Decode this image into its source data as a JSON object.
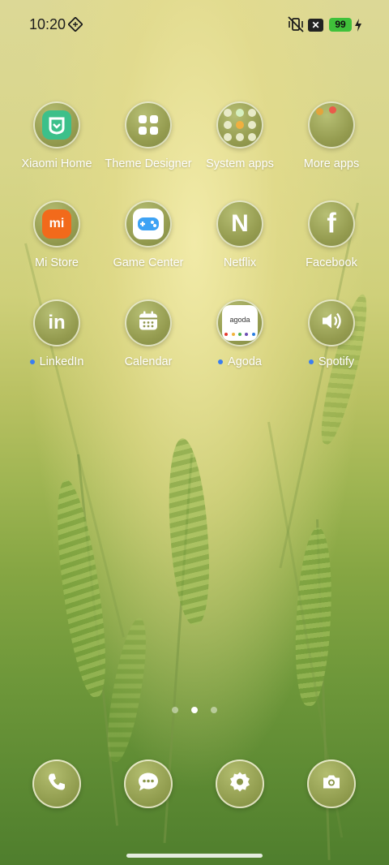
{
  "status_bar": {
    "time": "10:20",
    "battery_level": "99",
    "icons": [
      "nfc-icon",
      "mute-vibrate-icon",
      "xbox-badge-icon",
      "battery-icon",
      "charging-icon"
    ]
  },
  "apps": [
    {
      "label": "Xiaomi Home",
      "icon": "xiaomi-home-icon",
      "notification": false
    },
    {
      "label": "Theme Designer",
      "icon": "theme-designer-icon",
      "notification": false
    },
    {
      "label": "System apps",
      "icon": "folder-icon",
      "notification": false
    },
    {
      "label": "More apps",
      "icon": "folder-icon",
      "notification": false
    },
    {
      "label": "Mi Store",
      "icon": "mi-store-icon",
      "notification": false
    },
    {
      "label": "Game Center",
      "icon": "game-center-icon",
      "notification": false
    },
    {
      "label": "Netflix",
      "icon": "netflix-icon",
      "notification": false
    },
    {
      "label": "Facebook",
      "icon": "facebook-icon",
      "notification": false
    },
    {
      "label": "LinkedIn",
      "icon": "linkedin-icon",
      "notification": true
    },
    {
      "label": "Calendar",
      "icon": "calendar-icon",
      "notification": false
    },
    {
      "label": "Agoda",
      "icon": "agoda-icon",
      "notification": true
    },
    {
      "label": "Spotify",
      "icon": "spotify-icon",
      "notification": true
    }
  ],
  "agoda_logo_text": "agoda",
  "xiaomi_logo_text": "mi",
  "netflix_letter": "N",
  "facebook_letter": "f",
  "linkedin_letters": "in",
  "pager": {
    "pages": 3,
    "active": 2
  },
  "dock": [
    "phone-icon",
    "messages-icon",
    "settings-icon",
    "camera-icon"
  ],
  "colors": {
    "notification_dot": "#3a7ef0",
    "battery": "#3fc13a",
    "mi_store_orange": "#f26a1b",
    "xiaomi_home_green": "#3cc08a"
  }
}
